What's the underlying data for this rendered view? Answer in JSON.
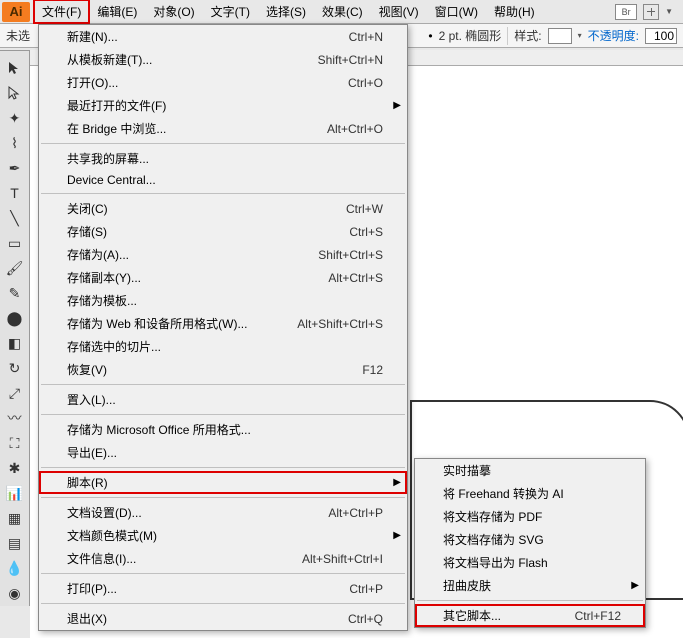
{
  "logo": "Ai",
  "menubar": {
    "file": "文件(F)",
    "edit": "编辑(E)",
    "object": "对象(O)",
    "text": "文字(T)",
    "select": "选择(S)",
    "effect": "效果(C)",
    "view": "视图(V)",
    "window": "窗口(W)",
    "help": "帮助(H)"
  },
  "menubar_right": {
    "br": "Br"
  },
  "optionbar": {
    "untitled": "未选",
    "stroke_value": "2 pt. 椭圆形",
    "style_label": "样式:",
    "opacity_label": "不透明度:",
    "opacity_value": "100"
  },
  "file_menu": {
    "new": "新建(N)...",
    "new_sc": "Ctrl+N",
    "from_template": "从模板新建(T)...",
    "from_template_sc": "Shift+Ctrl+N",
    "open": "打开(O)...",
    "open_sc": "Ctrl+O",
    "recent": "最近打开的文件(F)",
    "bridge": "在 Bridge 中浏览...",
    "bridge_sc": "Alt+Ctrl+O",
    "share_screen": "共享我的屏幕...",
    "device_central": "Device Central...",
    "close": "关闭(C)",
    "close_sc": "Ctrl+W",
    "save": "存储(S)",
    "save_sc": "Ctrl+S",
    "save_as": "存储为(A)...",
    "save_as_sc": "Shift+Ctrl+S",
    "save_copy": "存储副本(Y)...",
    "save_copy_sc": "Alt+Ctrl+S",
    "save_template": "存储为模板...",
    "save_web": "存储为 Web 和设备所用格式(W)...",
    "save_web_sc": "Alt+Shift+Ctrl+S",
    "save_slices": "存储选中的切片...",
    "revert": "恢复(V)",
    "revert_sc": "F12",
    "place": "置入(L)...",
    "save_ms": "存储为 Microsoft Office 所用格式...",
    "export": "导出(E)...",
    "scripts": "脚本(R)",
    "doc_setup": "文档设置(D)...",
    "doc_setup_sc": "Alt+Ctrl+P",
    "color_mode": "文档颜色模式(M)",
    "file_info": "文件信息(I)...",
    "file_info_sc": "Alt+Shift+Ctrl+I",
    "print": "打印(P)...",
    "print_sc": "Ctrl+P",
    "exit": "退出(X)",
    "exit_sc": "Ctrl+Q"
  },
  "scripts_submenu": {
    "live_trace": "实时描摹",
    "freehand": "将 Freehand 转换为 AI",
    "save_pdf": "将文档存储为 PDF",
    "save_svg": "将文档存储为 SVG",
    "export_flash": "将文档导出为 Flash",
    "warp": "扭曲皮肤",
    "other": "其它脚本...",
    "other_sc": "Ctrl+F12"
  }
}
